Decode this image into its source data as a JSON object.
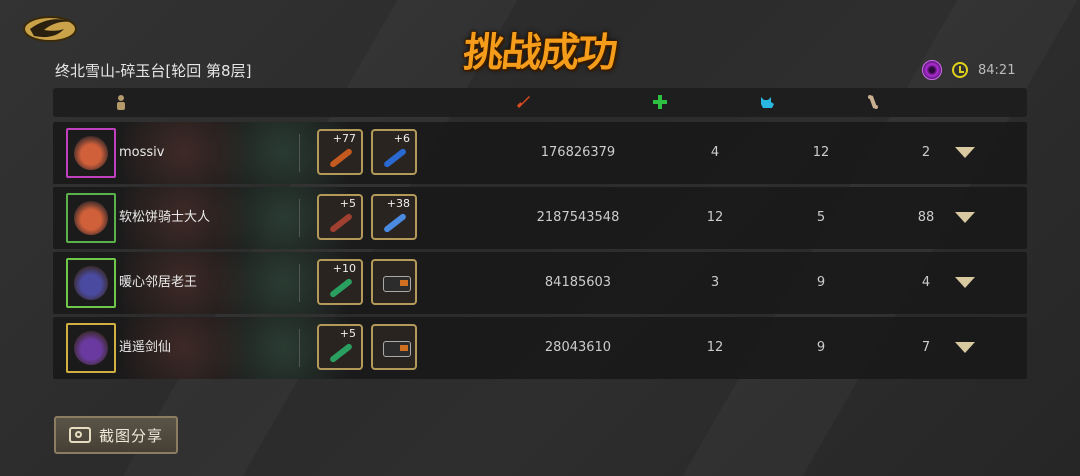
{
  "title": "挑战成功",
  "stage": "终北雪山-碎玉台[轮回 第8层]",
  "timer": "84:21",
  "header_icons": [
    "player-icon",
    "damage-sword-icon",
    "heal-cross-icon",
    "mount-fox-icon",
    "bone-icon"
  ],
  "colors": {
    "accent": "#f59d1a",
    "item_border": "#b49a5a"
  },
  "players": [
    {
      "name": "mossiv",
      "avatar_border": "#c040c0",
      "face": "#d0603a",
      "items": [
        {
          "plus": "+77",
          "weapon": "#c45a20"
        },
        {
          "plus": "+6",
          "weapon": "#2a6ad0"
        }
      ],
      "damage": "176826379",
      "heal": "4",
      "col3": "12",
      "col4": "2"
    },
    {
      "name": "软松饼骑士大人",
      "avatar_border": "#5ab04a",
      "face": "#d0603a",
      "items": [
        {
          "plus": "+5",
          "weapon": "#a04030"
        },
        {
          "plus": "+38",
          "weapon": "#4a8ae0"
        }
      ],
      "damage": "2187543548",
      "heal": "12",
      "col3": "5",
      "col4": "88"
    },
    {
      "name": "暖心邻居老王",
      "avatar_border": "#70c84a",
      "face": "#4a4aa0",
      "items": [
        {
          "plus": "+10",
          "weapon": "#2aa060"
        },
        {
          "plus": "",
          "weapon": ""
        }
      ],
      "damage": "84185603",
      "heal": "3",
      "col3": "9",
      "col4": "4"
    },
    {
      "name": "逍遥剑仙",
      "avatar_border": "#d0b040",
      "face": "#6a3aa0",
      "items": [
        {
          "plus": "+5",
          "weapon": "#2aa060"
        },
        {
          "plus": "",
          "weapon": ""
        }
      ],
      "damage": "28043610",
      "heal": "12",
      "col3": "9",
      "col4": "7"
    }
  ],
  "share_button": "截图分享"
}
